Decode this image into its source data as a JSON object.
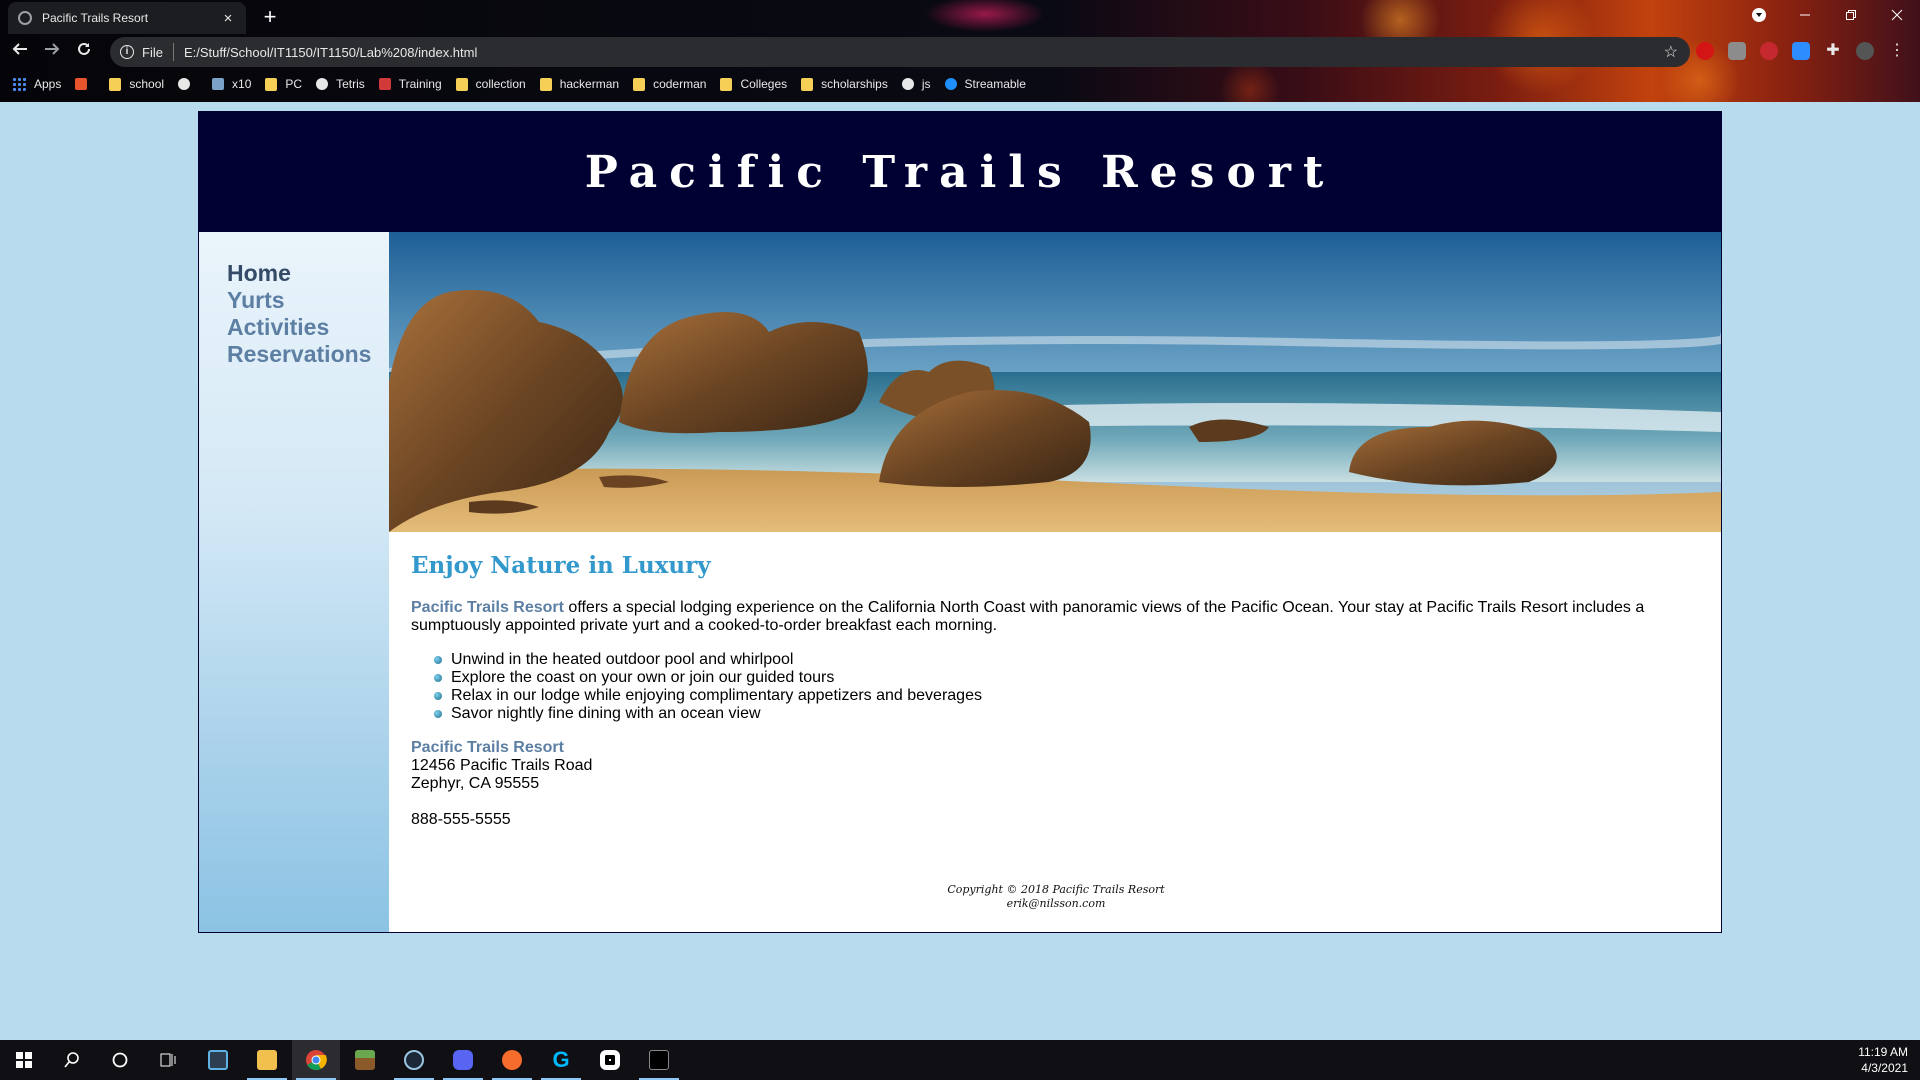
{
  "browser": {
    "tab_title": "Pacific Trails Resort",
    "tab_close": "×",
    "new_tab": "+",
    "scheme_label": "File",
    "url": "E:/Stuff/School/IT1150/IT1150/Lab%208/index.html",
    "bookmarks": [
      {
        "label": "Apps",
        "icon": "apps-grid-icon"
      },
      {
        "label": "",
        "icon": "red-square-icon"
      },
      {
        "label": "school",
        "icon": "folder-icon"
      },
      {
        "label": "",
        "icon": "globe-icon"
      },
      {
        "label": "x10",
        "icon": "x10-icon"
      },
      {
        "label": "PC",
        "icon": "folder-icon"
      },
      {
        "label": "Tetris",
        "icon": "globe-icon"
      },
      {
        "label": "Training",
        "icon": "training-icon"
      },
      {
        "label": "collection",
        "icon": "folder-icon"
      },
      {
        "label": "hackerman",
        "icon": "folder-icon"
      },
      {
        "label": "coderman",
        "icon": "folder-icon"
      },
      {
        "label": "Colleges",
        "icon": "folder-icon"
      },
      {
        "label": "scholarships",
        "icon": "folder-icon"
      },
      {
        "label": "js",
        "icon": "at-icon"
      },
      {
        "label": "Streamable",
        "icon": "streamable-icon"
      }
    ]
  },
  "page": {
    "site_title": "Pacific Trails Resort",
    "nav": [
      {
        "label": "Home",
        "current": true
      },
      {
        "label": "Yurts",
        "current": false
      },
      {
        "label": "Activities",
        "current": false
      },
      {
        "label": "Reservations",
        "current": false
      }
    ],
    "heading": "Enjoy Nature in Luxury",
    "intro_brand": "Pacific Trails Resort",
    "intro_text": " offers a special lodging experience on the California North Coast with panoramic views of the Pacific Ocean. Your stay at Pacific Trails Resort includes a sumptuously appointed private yurt and a cooked-to-order breakfast each morning.",
    "features": [
      "Unwind in the heated outdoor pool and whirlpool",
      "Explore the coast on your own or join our guided tours",
      "Relax in our lodge while enjoying complimentary appetizers and beverages",
      "Savor nightly fine dining with an ocean view"
    ],
    "address_name": "Pacific Trails Resort",
    "address_street": "12456 Pacific Trails Road",
    "address_city": "Zephyr, CA 95555",
    "phone": "888-555-5555",
    "copyright": "Copyright © 2018 Pacific Trails Resort",
    "email": "erik@nilsson.com"
  },
  "taskbar": {
    "time": "11:19 AM",
    "date": "4/3/2021",
    "icons": [
      "windows-start-icon",
      "search-icon",
      "cortana-icon",
      "task-view-icon",
      "app-icon",
      "file-explorer-icon",
      "chrome-icon",
      "minecraft-icon",
      "steam-icon",
      "discord-icon",
      "origin-icon",
      "logitech-icon",
      "oculus-icon",
      "terminal-icon"
    ]
  },
  "colors": {
    "header_bg": "#000033",
    "page_bg": "#b9dbee",
    "heading": "#3399cc",
    "nav_link": "#5c7fa3"
  }
}
